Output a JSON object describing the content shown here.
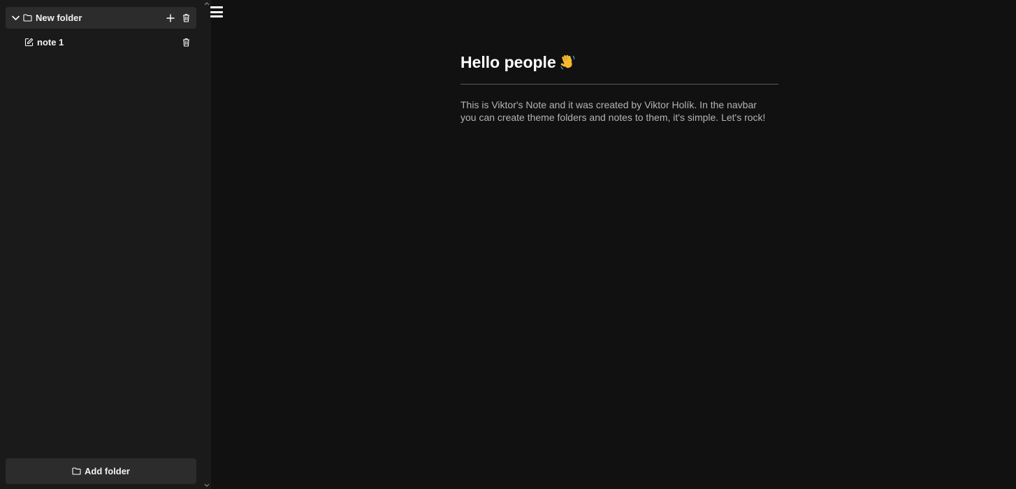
{
  "sidebar": {
    "folders": [
      {
        "name": "New folder",
        "expanded": true,
        "notes": [
          {
            "title": "note 1"
          }
        ]
      }
    ],
    "add_folder_label": "Add folder"
  },
  "note": {
    "title": "Hello people",
    "emoji": "waving-hand",
    "body": "This is Viktor's Note and it was created by Viktor Holík. In the navbar you can create theme folders and notes to them, it's simple. Let's rock!"
  },
  "icons": {
    "chevron": "chevron-down-icon",
    "folder": "folder-icon",
    "add": "plus-icon",
    "delete": "trash-icon",
    "note": "edit-note-icon",
    "menu": "hamburger-menu-icon"
  },
  "colors": {
    "background": "#111111",
    "sidebar": "#1a1a1a",
    "row_highlight": "#2c2c2c",
    "text": "#ffffff",
    "body_text": "#b4b4b4"
  }
}
